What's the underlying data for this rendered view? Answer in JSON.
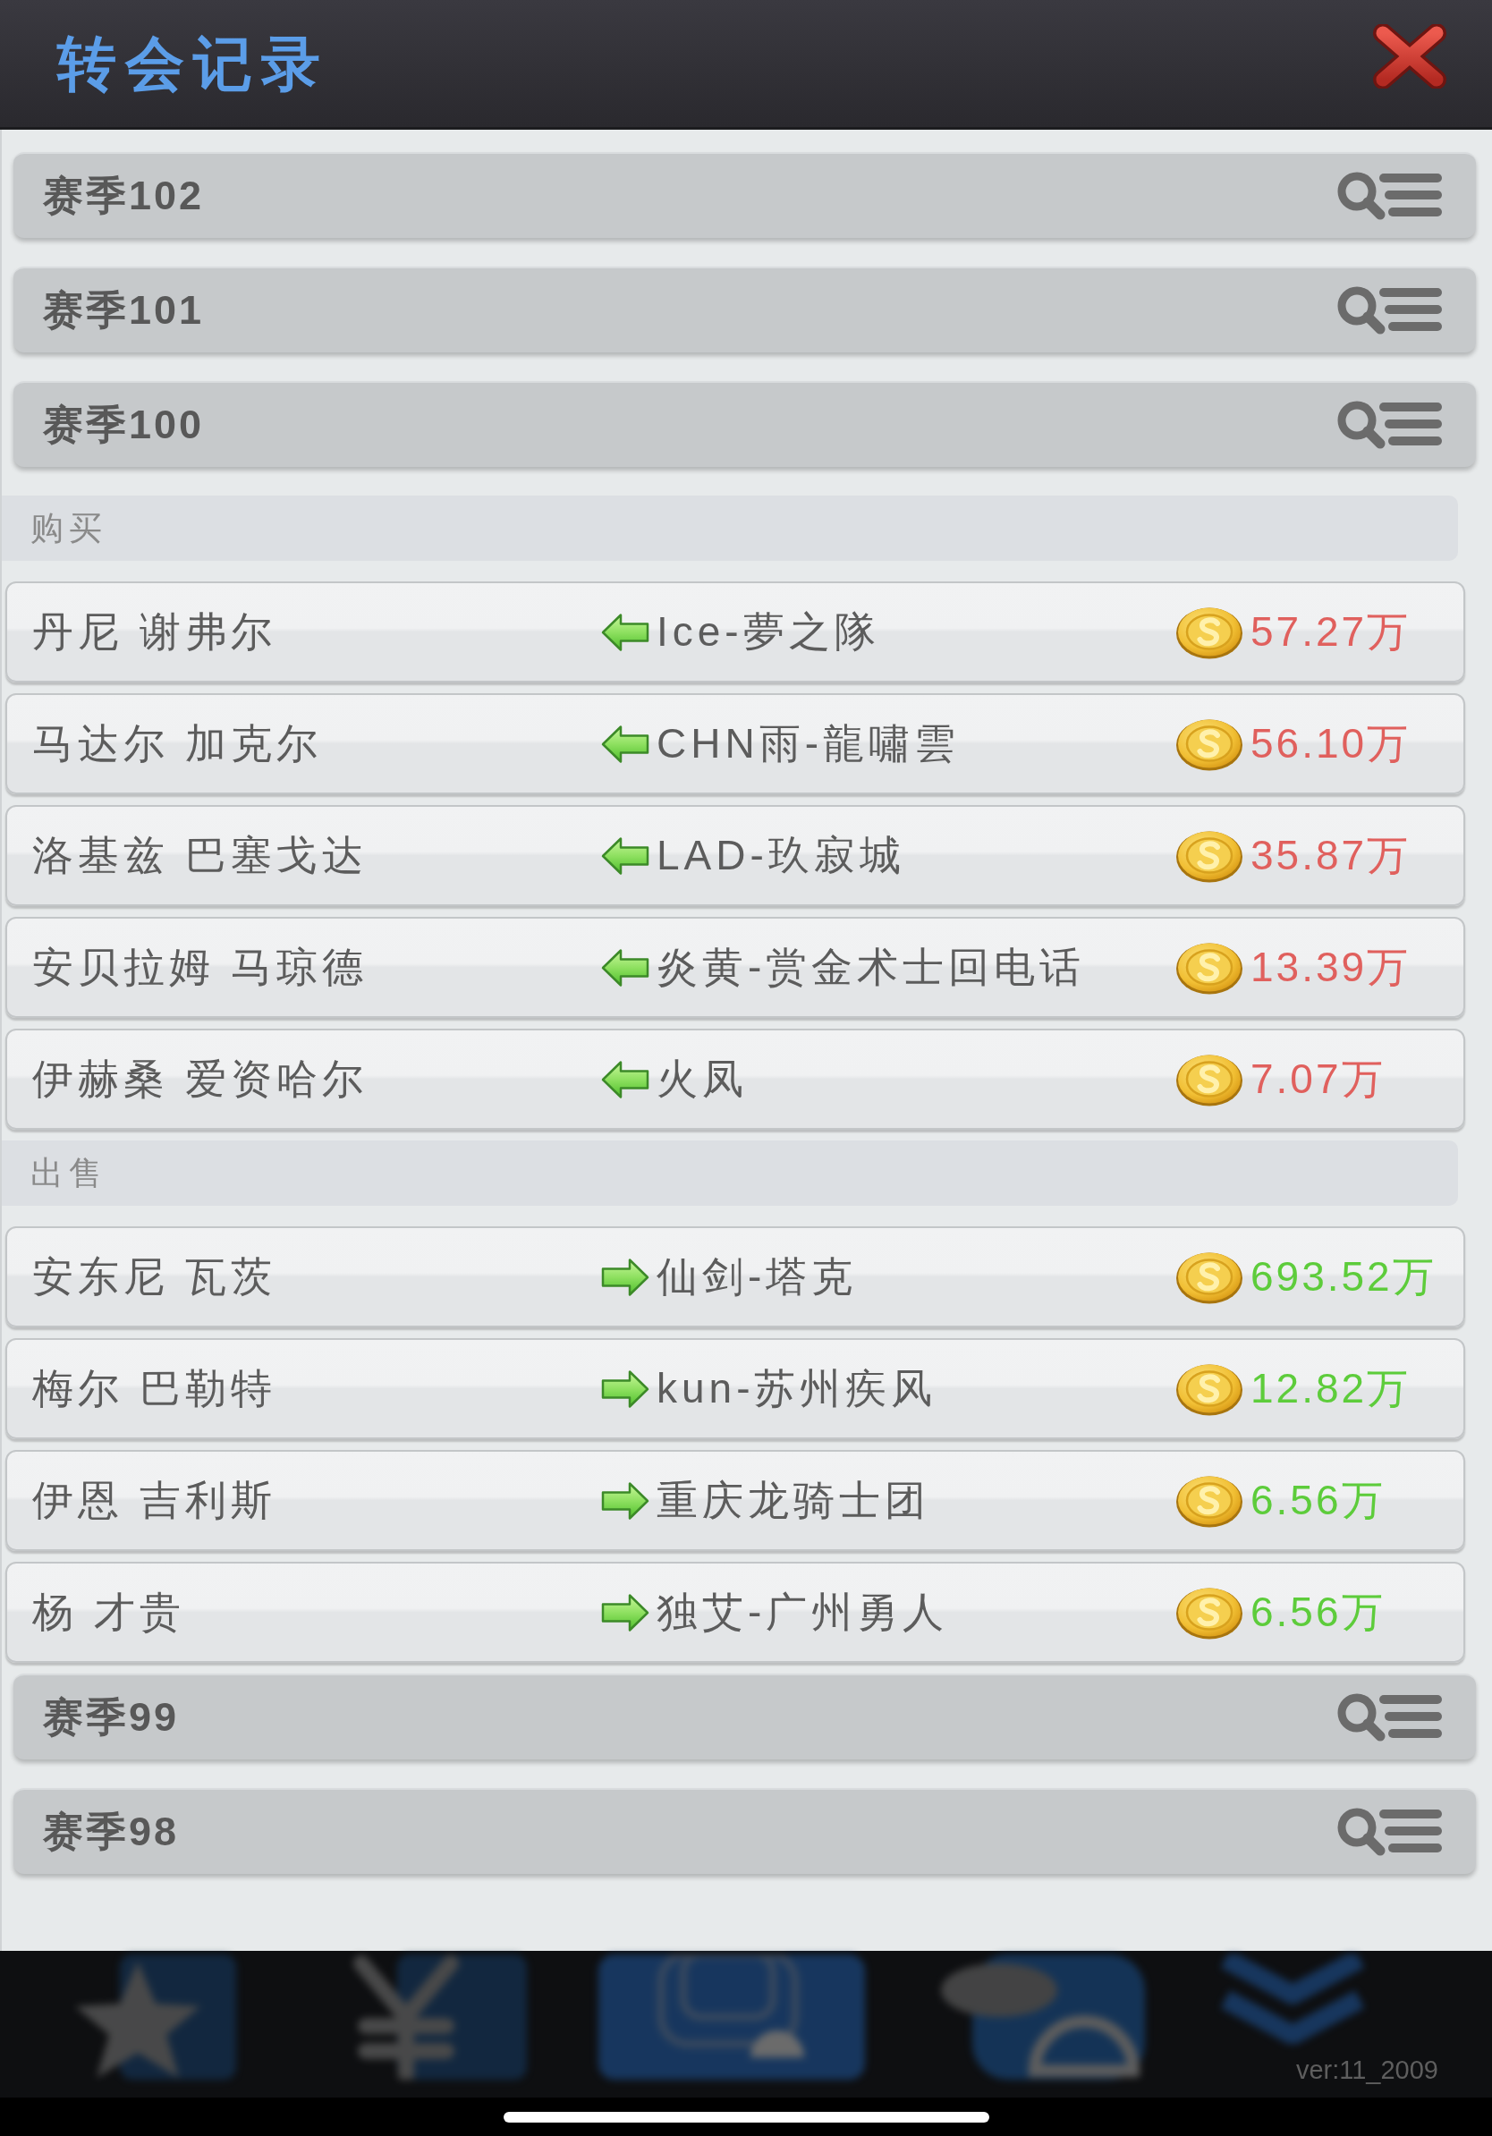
{
  "window": {
    "title": "转会记录"
  },
  "seasons": [
    {
      "label": "赛季102"
    },
    {
      "label": "赛季101"
    },
    {
      "label": "赛季100",
      "sections": [
        {
          "kind": "buy",
          "title": "购买",
          "transfers": [
            {
              "player": "丹尼 谢弗尔",
              "club": "Ice-夢之隊",
              "fee": "57.27万"
            },
            {
              "player": "马达尔 加克尔",
              "club": "CHN雨-龍嘯雲",
              "fee": "56.10万"
            },
            {
              "player": "洛基兹 巴塞戈达",
              "club": "LAD-玖寂城",
              "fee": "35.87万"
            },
            {
              "player": "安贝拉姆 马琼德",
              "club": "炎黄-赏金术士回电话",
              "fee": "13.39万"
            },
            {
              "player": "伊赫桑 爱资哈尔",
              "club": "火凤",
              "fee": "7.07万"
            }
          ]
        },
        {
          "kind": "sell",
          "title": "出售",
          "transfers": [
            {
              "player": "安东尼 瓦茨",
              "club": "仙剑-塔克",
              "fee": "693.52万"
            },
            {
              "player": "梅尔 巴勒特",
              "club": "kun-苏州疾风",
              "fee": "12.82万"
            },
            {
              "player": "伊恩 吉利斯",
              "club": "重庆龙骑士团",
              "fee": "6.56万"
            },
            {
              "player": "杨 才贵",
              "club": "独艾-广州勇人",
              "fee": "6.56万"
            }
          ]
        }
      ]
    },
    {
      "label": "赛季99"
    },
    {
      "label": "赛季98"
    }
  ],
  "bottom_bar": {
    "version": "ver:11_2009"
  }
}
